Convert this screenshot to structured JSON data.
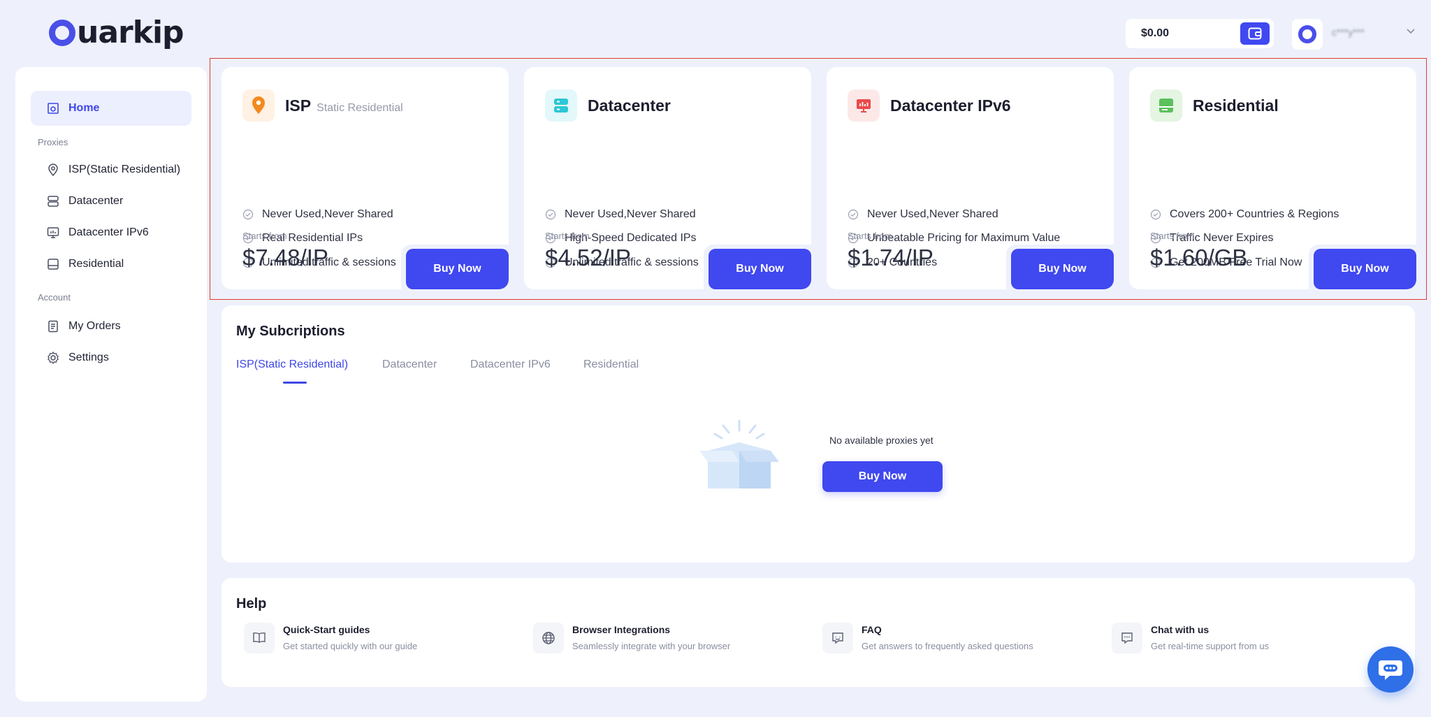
{
  "header": {
    "logo_text": "uarkip",
    "balance": "$0.00",
    "username": "c***y***"
  },
  "sidebar": {
    "home": "Home",
    "proxies_section": "Proxies",
    "proxies": [
      "ISP(Static Residential)",
      "Datacenter",
      "Datacenter IPv6",
      "Residential"
    ],
    "account_section": "Account",
    "account": [
      "My Orders",
      "Settings"
    ]
  },
  "products": [
    {
      "title": "ISP",
      "subtitle": "Static Residential",
      "features": [
        "Never Used,Never Shared",
        "Real Residential IPs",
        "Unlimited traffic & sessions"
      ],
      "starts_label": "Starts from",
      "price": "$7.48/IP",
      "buy_label": "Buy Now",
      "icon": "location-pin-icon",
      "color": "#f28a1e"
    },
    {
      "title": "Datacenter",
      "subtitle": "",
      "features": [
        "Never Used,Never Shared",
        "High-Speed Dedicated IPs",
        "Unlimited traffic & sessions"
      ],
      "starts_label": "Starts from",
      "price": "$4.52/IP",
      "buy_label": "Buy Now",
      "icon": "server-icon",
      "color": "#2cc7d6"
    },
    {
      "title": "Datacenter IPv6",
      "subtitle": "",
      "features": [
        "Never Used,Never Shared",
        "Unbeatable Pricing for Maximum Value",
        "20+ Countries"
      ],
      "starts_label": "Starts from",
      "price": "$1.74/IP",
      "buy_label": "Buy Now",
      "icon": "monitor-icon",
      "color": "#ea4a4a"
    },
    {
      "title": "Residential",
      "subtitle": "",
      "features": [
        "Covers 200+ Countries & Regions",
        "Traffic Never Expires",
        "Get 200MB Free Trial Now"
      ],
      "starts_label": "Starts from",
      "price": "$1.60/GB",
      "buy_label": "Buy Now",
      "icon": "residential-icon",
      "color": "#5cc05c"
    }
  ],
  "subscriptions": {
    "title": "My Subcriptions",
    "tabs": [
      "ISP(Static Residential)",
      "Datacenter",
      "Datacenter IPv6",
      "Residential"
    ],
    "active_tab": 0,
    "empty_text": "No available proxies yet",
    "buy_label": "Buy Now"
  },
  "help": {
    "title": "Help",
    "items": [
      {
        "title": "Quick-Start guides",
        "desc": "Get started quickly with our guide",
        "icon": "book-icon"
      },
      {
        "title": "Browser Integrations",
        "desc": "Seamlessly integrate with your browser",
        "icon": "globe-icon"
      },
      {
        "title": "FAQ",
        "desc": "Get answers to frequently asked questions",
        "icon": "faq-icon"
      },
      {
        "title": "Chat with us",
        "desc": "Get real-time support from us",
        "icon": "chat-icon"
      }
    ]
  },
  "colors": {
    "accent": "#4048f0",
    "background": "#eef1fb"
  }
}
